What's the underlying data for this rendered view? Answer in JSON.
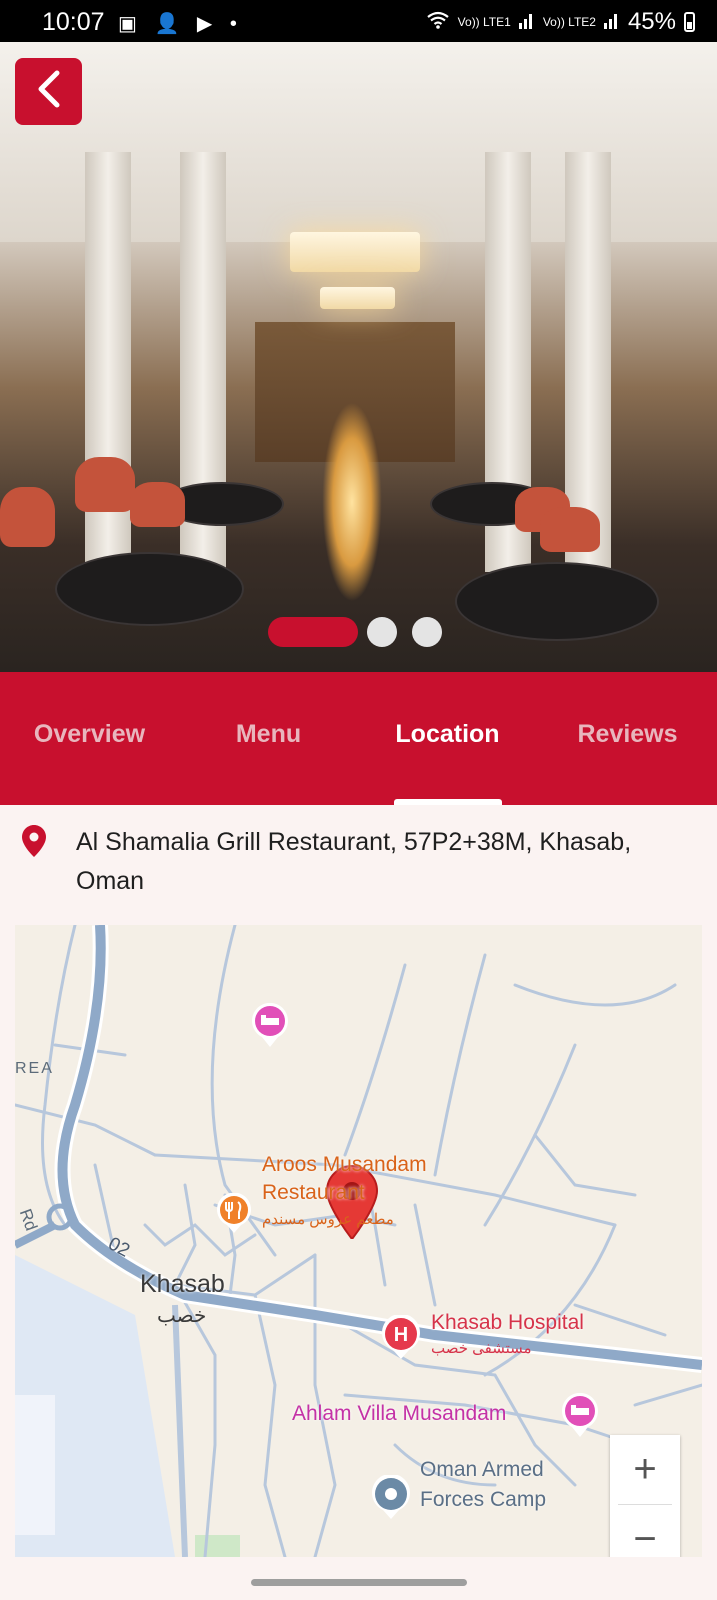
{
  "status_bar": {
    "time": "10:07",
    "notification_icons": "▣ 👤 ▶ •",
    "network_1": "Vo)) LTE1",
    "network_2": "Vo)) LTE2",
    "battery": "45%"
  },
  "hero": {
    "back_icon": "chevron-left-icon",
    "carousel": {
      "total": 3,
      "active_index": 0
    }
  },
  "tabs": [
    {
      "label": "Overview"
    },
    {
      "label": "Menu"
    },
    {
      "label": "Location"
    },
    {
      "label": "Reviews"
    }
  ],
  "active_tab": "Location",
  "location": {
    "address": "Al Shamalia Grill Restaurant, 57P2+38M, Khasab, Oman"
  },
  "map": {
    "labels": {
      "area": "REA",
      "road_rd": "Rd",
      "road_02": "02",
      "city": "Khasab",
      "city_ar": "خصب",
      "restaurant_1": "Aroos Musandam",
      "restaurant_2": "Restaurant",
      "restaurant_ar": "مطعم عروس مسندم",
      "hospital": "Khasab Hospital",
      "hospital_ar": "مستشفى خصب",
      "villa": "Ahlam Villa Musandam",
      "camp_1": "Oman Armed",
      "camp_2": "Forces Camp"
    },
    "zoom_in": "+",
    "zoom_out": "−"
  },
  "colors": {
    "brand_red": "#c8102e",
    "tab_inactive": "#e8b6bd",
    "background": "#fbf3f2"
  }
}
